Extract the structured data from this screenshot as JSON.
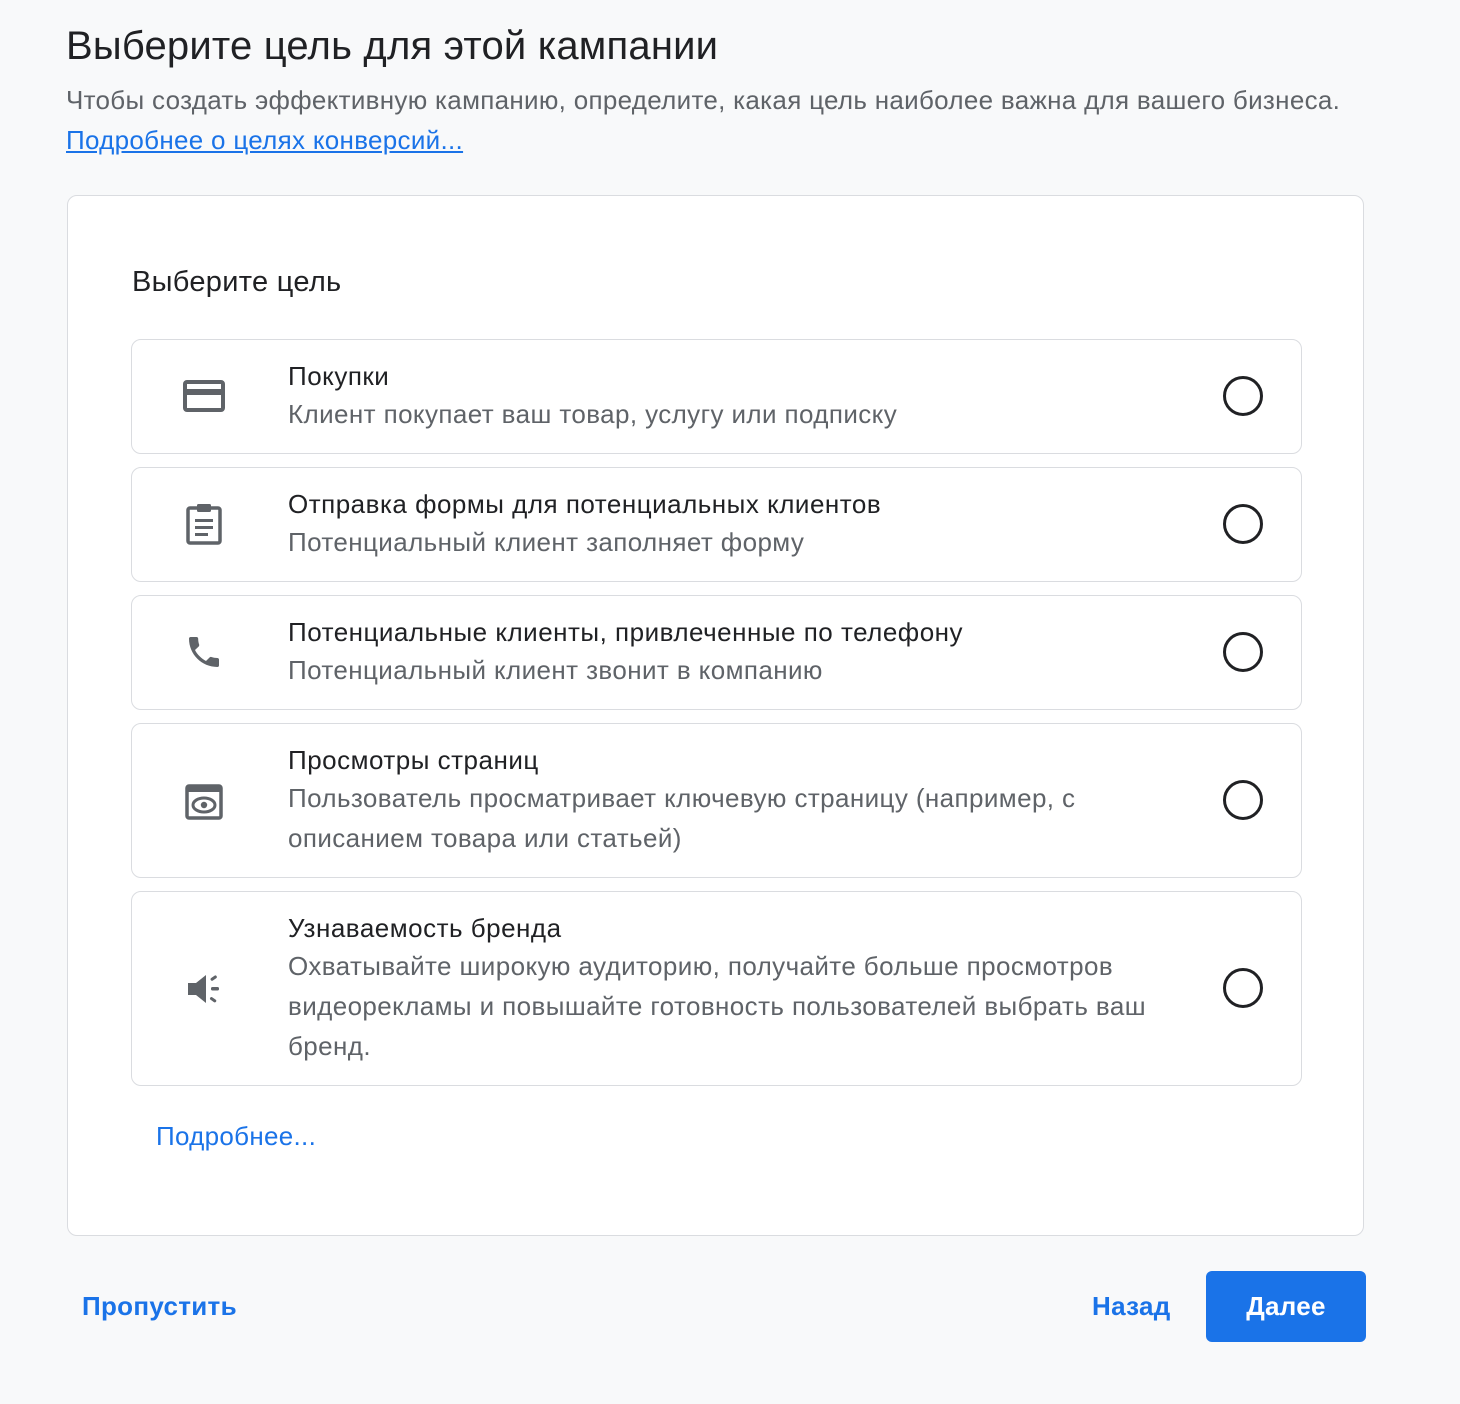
{
  "header": {
    "title": "Выберите цель для этой кампании",
    "description": "Чтобы создать эффективную кампанию, определите, какая цель наиболее важна для вашего бизнеса.",
    "learn_link": "Подробнее о целях конверсий..."
  },
  "card": {
    "title": "Выберите цель",
    "options": [
      {
        "icon": "credit-card-icon",
        "label": "Покупки",
        "sublabel": "Клиент покупает ваш товар, услугу или подписку",
        "selected": false
      },
      {
        "icon": "clipboard-form-icon",
        "label": "Отправка формы для потенциальных клиентов",
        "sublabel": "Потенциальный клиент заполняет форму",
        "selected": false
      },
      {
        "icon": "phone-icon",
        "label": "Потенциальные клиенты, привлеченные по телефону",
        "sublabel": "Потенциальный клиент звонит в компанию",
        "selected": false
      },
      {
        "icon": "page-view-eye-icon",
        "label": "Просмотры страниц",
        "sublabel": "Пользователь просматривает ключевую страницу (например, с описанием товара или статьей)",
        "selected": false
      },
      {
        "icon": "megaphone-icon",
        "label": "Узнаваемость бренда",
        "sublabel": "Охватывайте широкую аудиторию, получайте больше просмотров видеорекламы и повышайте готовность пользователей выбрать ваш бренд.",
        "selected": false
      }
    ],
    "more_link": "Подробнее..."
  },
  "footer": {
    "skip_label": "Пропустить",
    "back_label": "Назад",
    "next_label": "Далее"
  },
  "colors": {
    "accent": "#1a73e8",
    "text_primary": "#202124",
    "text_secondary": "#5f6368",
    "border": "#dadce0"
  }
}
